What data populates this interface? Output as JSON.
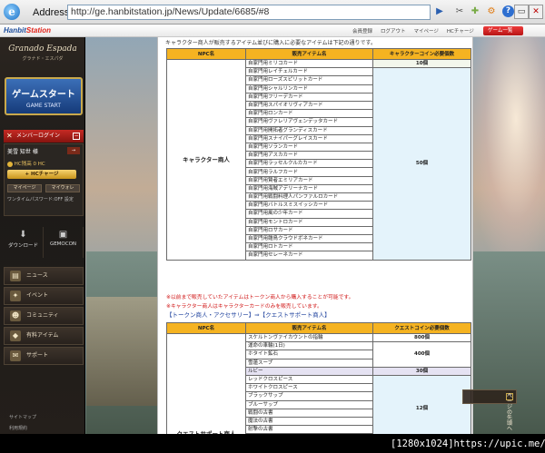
{
  "browser": {
    "address_label": "Address:",
    "url": "http://ge.hanbitstation.jp/News/Update/6685/#8"
  },
  "topbar": {
    "logo_main": "Hanbit",
    "logo_accent": "Station",
    "links": [
      "会員登録",
      "ログアウト",
      "マイページ",
      "HCチャージ"
    ],
    "select_label": "ゲーム一覧"
  },
  "sidebar": {
    "logo_title": "Granado Espada",
    "logo_sub": "グラナド・エスパダ",
    "start_jp": "ゲームスタート",
    "start_en": "GAME START",
    "login_header": "メンバーログイン",
    "user_name": "美雪 知世 様",
    "coins_text": "HC残高 0 HC",
    "charge_label": "+ HCチャージ",
    "mypage_label": "マイページ",
    "mywallet_label": "マイウォレ",
    "otp_text": "ワンタイムパスワード:OFF 設定",
    "download_label": "ダウンロード",
    "gemocon_label": "GEMOCON",
    "nav": [
      "ニュース",
      "イベント",
      "コミュニティ",
      "有料アイテム",
      "サポート"
    ],
    "sub_links": [
      "サイトマップ",
      "利用規約"
    ]
  },
  "content": {
    "intro": "キャラクター商人が販売するアイテム並びに購入に必要なアイテムは下記の通りです。",
    "table1": {
      "headers": [
        "NPC名",
        "販売アイテム名",
        "キャラクターコイン必要個数"
      ],
      "npc": "キャラクター商人",
      "items": [
        "自家門用ミリコカード",
        "自家門用レイチェルカード",
        "自家門用ローズスピリットカード",
        "自家門用シャルリンカード",
        "自家門用フリーデカード",
        "自家門用スパイオリヴィアカード",
        "自家門用ロンカード",
        "自家門用ヴァレリアヴェンデッタカード",
        "自家門用開拓者グランディスカード",
        "自家門用スナイパーグレイスカード",
        "自家門用ソランカード",
        "自家門用アスカカード",
        "自家門用ラッセルクルカカード",
        "自家門用ラルフカード",
        "自家門用賢者エミリアカード",
        "自家門用海賊アデリーナカード",
        "自家門用戦闘料理人パンファルロカード",
        "自家門用バトルスミスイッシカード",
        "自家門用風の少年カード",
        "自家門用モントロカード",
        "自家門用ロサカード",
        "自家門用雛鳥クラウドボネカード",
        "自家門用ロトカード",
        "自家門用セレーネカード"
      ],
      "coin_first": "10個",
      "coin_rest": "50個"
    },
    "note1": "※以前まで販売していたアイテムはトークン商人から購入することが可能です。",
    "note2": "※キャラクター商人はキャラクターカードのみを販売しています。",
    "section2_title": "【トークン商人・アクセサリー】⇒【クエストサポート商人】",
    "table2": {
      "headers": [
        "NPC名",
        "販売アイテム名",
        "クエストコイン必要個数"
      ],
      "npc": "クエストサポート商人",
      "items": [
        "スケルトンヴァイカウントの指輪",
        "運命の車輪(1日)",
        "ホタイト鉱石",
        "雪蓮スープ",
        "ルビー",
        "レッドクロスピース",
        "ホワイトクロスピース",
        "ブラックサップ",
        "ブルーサップ",
        "戦闘の古書",
        "魔法の古書",
        "射撃の古書",
        "素材の欠片"
      ],
      "coins": [
        "800個",
        "400個",
        "30個",
        "12個"
      ]
    },
    "page_top": "ページの先頭へ"
  },
  "status_overlay": "[1280x1024]https://upic.me/"
}
